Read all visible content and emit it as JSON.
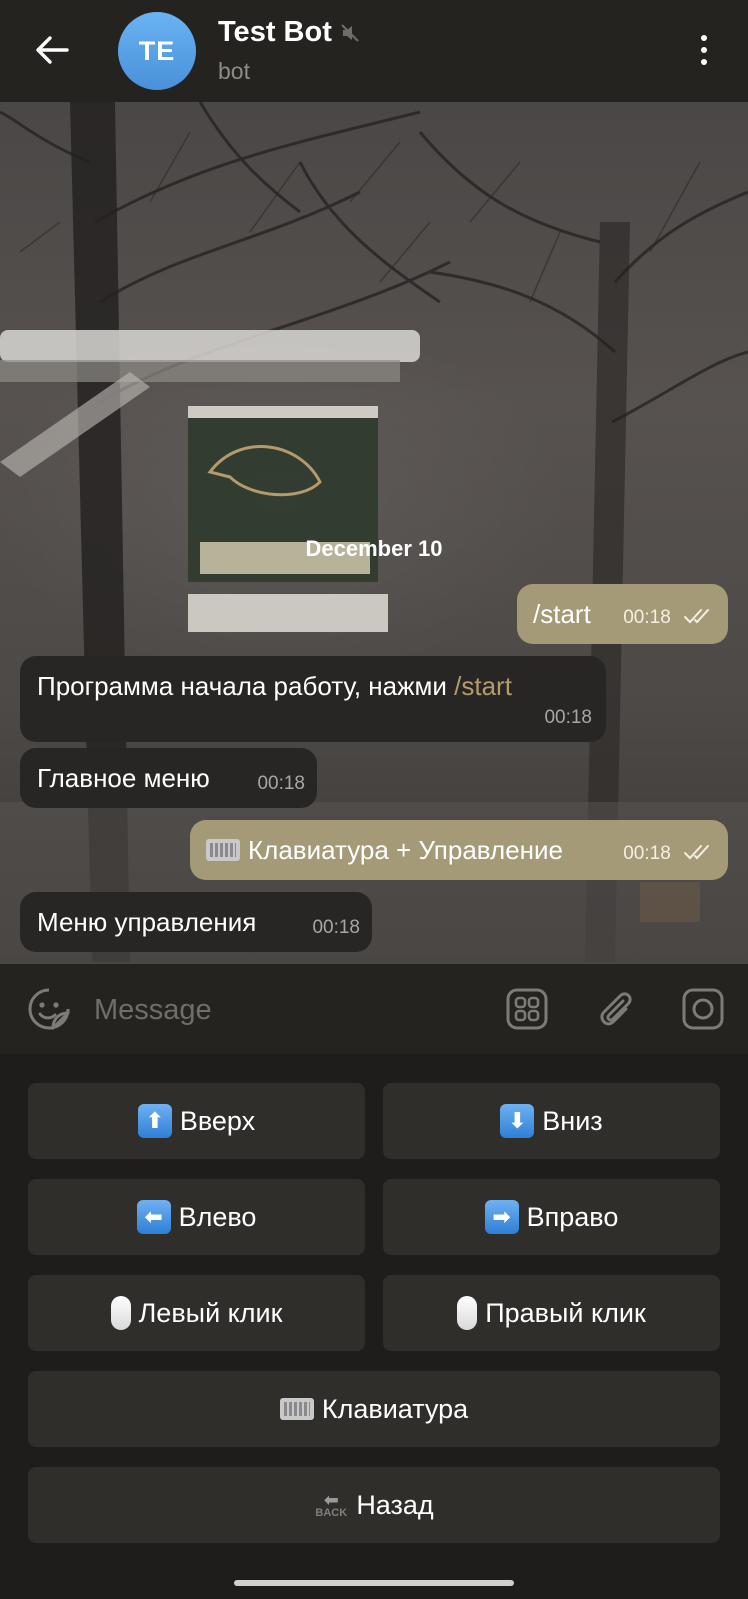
{
  "header": {
    "title": "Test Bot",
    "subtitle": "bot",
    "avatar_initials": "TE",
    "muted_icon": "muted-speaker-icon",
    "back_icon": "arrow-left-icon",
    "menu_icon": "more-vertical-icon"
  },
  "chat": {
    "date_label": "December 10",
    "messages": [
      {
        "direction": "out",
        "text": "/start",
        "time": "00:18",
        "status": "read"
      },
      {
        "direction": "in",
        "text": "Программа начала работу, нажми ",
        "link": "/start",
        "time": "00:18"
      },
      {
        "direction": "in",
        "text": "Главное меню",
        "time": "00:18"
      },
      {
        "direction": "out",
        "text": "Клавиатура + Управление",
        "emoji": "keyboard",
        "time": "00:18",
        "status": "read"
      },
      {
        "direction": "in",
        "text": "Меню управления",
        "time": "00:18"
      }
    ]
  },
  "input": {
    "placeholder": "Message",
    "emoji_icon": "sticker-smile-icon",
    "commands_icon": "bot-commands-grid-icon",
    "attach_icon": "paperclip-icon",
    "camera_icon": "camera-icon"
  },
  "keyboard": {
    "buttons": [
      {
        "label": "Вверх",
        "emoji": "arrow-up"
      },
      {
        "label": "Вниз",
        "emoji": "arrow-down"
      },
      {
        "label": "Влево",
        "emoji": "arrow-left"
      },
      {
        "label": "Вправо",
        "emoji": "arrow-right"
      },
      {
        "label": "Левый клик",
        "emoji": "mouse"
      },
      {
        "label": "Правый клик",
        "emoji": "mouse"
      },
      {
        "label": "Клавиатура",
        "emoji": "keyboard"
      },
      {
        "label": "Назад",
        "emoji": "back-arrow"
      }
    ],
    "back_emoji_text": "BACK"
  },
  "colors": {
    "header_bg": "#242320",
    "outgoing_bubble": "#a59a78",
    "incoming_bubble": "#272624",
    "keyboard_button": "#2f2e2b",
    "link": "#b49b6e"
  }
}
